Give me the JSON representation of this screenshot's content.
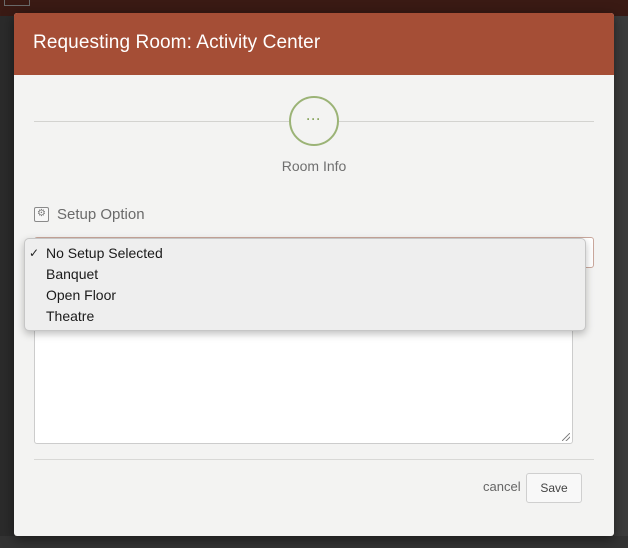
{
  "modal": {
    "title": "Requesting Room: Activity Center",
    "step": {
      "dots": "···",
      "label": "Room Info"
    },
    "setup": {
      "label": "Setup Option",
      "icon": "gear-icon",
      "options": [
        "No Setup Selected",
        "Banquet",
        "Open Floor",
        "Theatre"
      ],
      "selected_index": 0,
      "check_mark": "✓"
    },
    "footer": {
      "cancel_label": "cancel",
      "save_label": "Save"
    }
  },
  "colors": {
    "header": "#a54e36",
    "step_accent": "#9bb376",
    "modal_bg": "#f3f3f2"
  }
}
